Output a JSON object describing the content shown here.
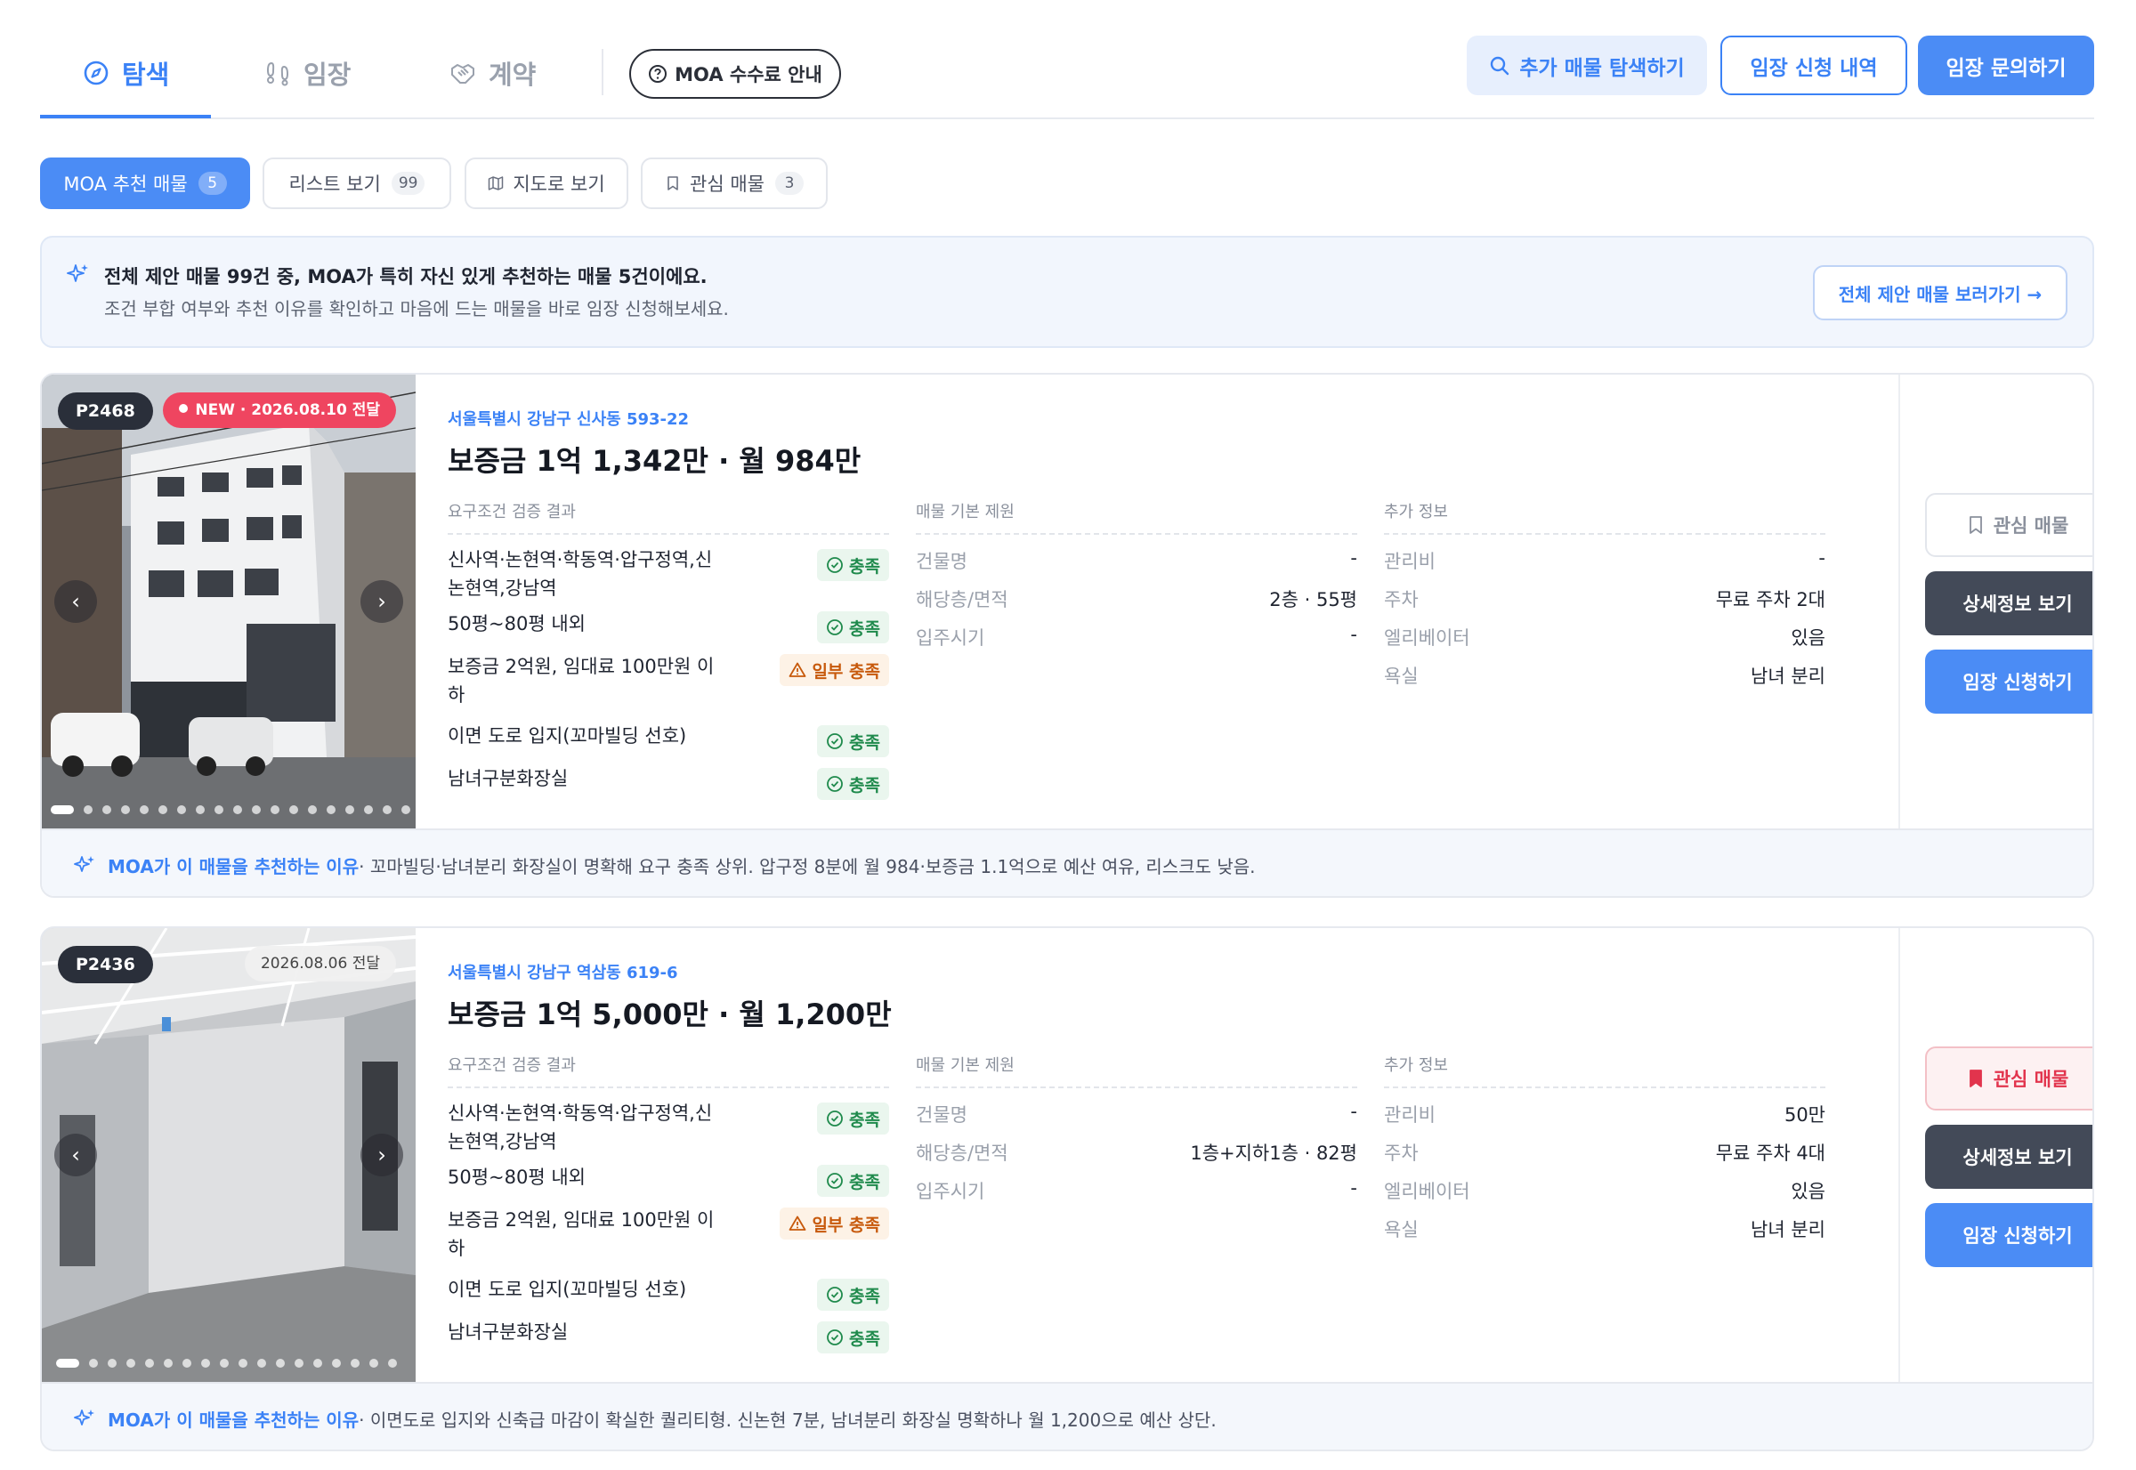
{
  "nav": {
    "tabs": [
      {
        "label": "탐색",
        "icon": "compass-icon"
      },
      {
        "label": "임장",
        "icon": "footprints-icon"
      },
      {
        "label": "계약",
        "icon": "handshake-icon"
      }
    ],
    "fee_guide": "MOA 수수료 안내",
    "search_more": "추가 매물 탐색하기",
    "history": "임장 신청 내역",
    "inquiry": "임장 문의하기"
  },
  "filters": [
    {
      "label": "MOA 추천 매물",
      "count": "5"
    },
    {
      "label": "리스트 보기",
      "count": "99"
    },
    {
      "label": "지도로 보기",
      "count": ""
    },
    {
      "label": "관심 매물",
      "count": "3"
    }
  ],
  "banner": {
    "title": "전체 제안 매물 99건 중, MOA가 특히 자신 있게 추천하는 매물 5건이에요.",
    "subtitle": "조건 부합 여부와 추천 이유를 확인하고 마음에 드는 매물을 바로 임장 신청해보세요.",
    "button": "전체 제안 매물 보러가기 →"
  },
  "headers": {
    "requirements": "요구조건 검증 결과",
    "basic": "매물 기본 제원",
    "extra": "추가 정보"
  },
  "buttons": {
    "favorite": "관심 매물",
    "detail": "상세정보 보기",
    "apply": "임장 신청하기"
  },
  "reason_label": "MOA가 이 매물을 추천하는 이유",
  "colors": {
    "accent": "#4b8cf5",
    "ok": "#1f8a4c",
    "partial": "#c7590b",
    "new": "#ef4560"
  },
  "listings": [
    {
      "id": "P2468",
      "date_badge": "NEW · 2026.08.10 전달",
      "is_new": true,
      "address": "서울특별시 강남구 신사동 593-22",
      "price": "보증금 1억 1,342만 · 월 984만",
      "requirements": [
        {
          "text": "신사역·논현역·학동역·압구정역,신논현역,강남역",
          "status": "충족"
        },
        {
          "text": "50평~80평 내외",
          "status": "충족"
        },
        {
          "text": "보증금 2억원, 임대료 100만원 이하",
          "status": "일부 충족"
        },
        {
          "text": "이면 도로 입지(꼬마빌딩 선호)",
          "status": "충족"
        },
        {
          "text": "남녀구분화장실",
          "status": "충족"
        }
      ],
      "basic": [
        {
          "k": "건물명",
          "v": "-"
        },
        {
          "k": "해당층/면적",
          "v": "2층 · 55평"
        },
        {
          "k": "입주시기",
          "v": "-"
        }
      ],
      "extra": [
        {
          "k": "관리비",
          "v": "-"
        },
        {
          "k": "주차",
          "v": "무료 주차 2대"
        },
        {
          "k": "엘리베이터",
          "v": "있음"
        },
        {
          "k": "욕실",
          "v": "남녀 분리"
        }
      ],
      "favorited": false,
      "reason": " · 꼬마빌딩·남녀분리 화장실이 명확해 요구 충족 상위. 압구정 8분에 월 984·보증금 1.1억으로 예산 여유, 리스크도 낮음."
    },
    {
      "id": "P2436",
      "date_badge": "2026.08.06 전달",
      "is_new": false,
      "address": "서울특별시 강남구 역삼동 619-6",
      "price": "보증금 1억 5,000만 · 월 1,200만",
      "requirements": [
        {
          "text": "신사역·논현역·학동역·압구정역,신논현역,강남역",
          "status": "충족"
        },
        {
          "text": "50평~80평 내외",
          "status": "충족"
        },
        {
          "text": "보증금 2억원, 임대료 100만원 이하",
          "status": "일부 충족"
        },
        {
          "text": "이면 도로 입지(꼬마빌딩 선호)",
          "status": "충족"
        },
        {
          "text": "남녀구분화장실",
          "status": "충족"
        }
      ],
      "basic": [
        {
          "k": "건물명",
          "v": "-"
        },
        {
          "k": "해당층/면적",
          "v": "1층+지하1층 · 82평"
        },
        {
          "k": "입주시기",
          "v": "-"
        }
      ],
      "extra": [
        {
          "k": "관리비",
          "v": "50만"
        },
        {
          "k": "주차",
          "v": "무료 주차 4대"
        },
        {
          "k": "엘리베이터",
          "v": "있음"
        },
        {
          "k": "욕실",
          "v": "남녀 분리"
        }
      ],
      "favorited": true,
      "reason": " · 이면도로 입지와 신축급 마감이 확실한 퀄리티형. 신논현 7분, 남녀분리 화장실 명확하나 월 1,200으로 예산 상단."
    }
  ]
}
